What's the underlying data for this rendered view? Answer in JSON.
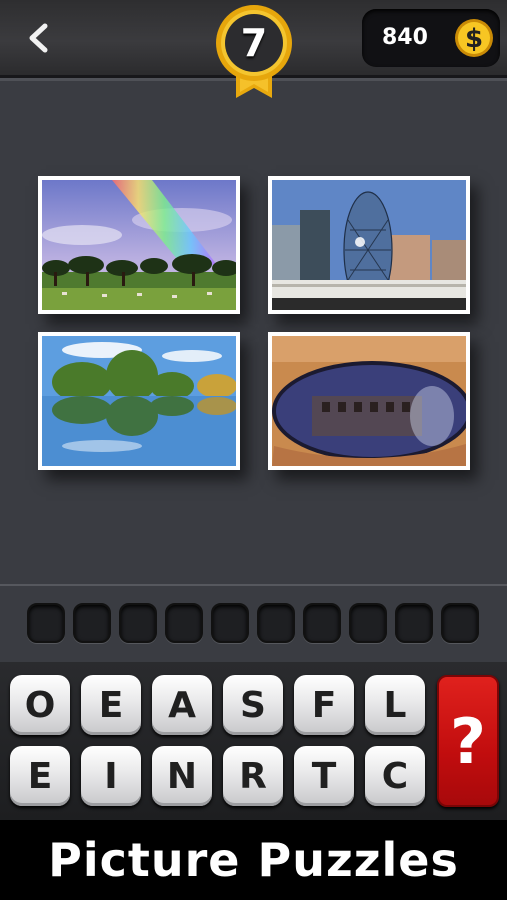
{
  "header": {
    "level": "7",
    "coins": "840",
    "back_icon": "chevron-left-icon",
    "coin_icon": "dollar-coin-icon",
    "badge_color": "#f2b619"
  },
  "photos": [
    {
      "subject": "rainbow over trees and field"
    },
    {
      "subject": "city skyline with glass tower"
    },
    {
      "subject": "trees reflected in lake"
    },
    {
      "subject": "building reflected in sunglasses"
    }
  ],
  "answer": {
    "slot_count": 10
  },
  "keyboard": {
    "row1": [
      "O",
      "E",
      "A",
      "S",
      "F",
      "L"
    ],
    "row2": [
      "E",
      "I",
      "N",
      "R",
      "T",
      "C"
    ],
    "hint_label": "?",
    "hint_color": "#d0151a"
  },
  "footer": {
    "title": "Picture Puzzles"
  }
}
